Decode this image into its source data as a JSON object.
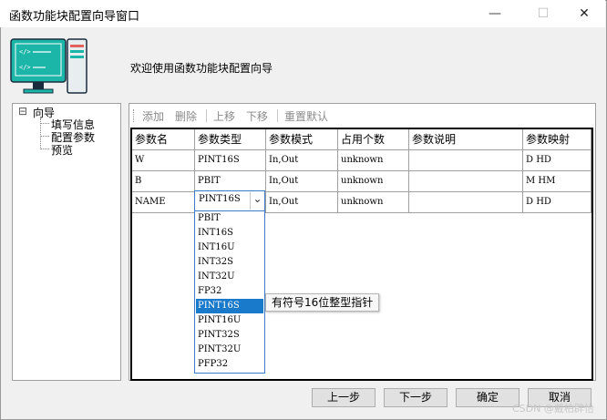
{
  "window": {
    "title": "函数功能块配置向导窗口",
    "minimize": "—",
    "maximize": "☐",
    "close": "✕"
  },
  "header": {
    "welcome": "欢迎使用函数功能块配置向导"
  },
  "tree": {
    "root": {
      "toggle": "⊟",
      "label": "向导"
    },
    "children": [
      "填写信息",
      "配置参数",
      "预览"
    ]
  },
  "toolbar": {
    "add": "添加",
    "delete": "删除",
    "move_up": "上移",
    "move_down": "下移",
    "reset": "重置默认"
  },
  "table": {
    "columns": [
      "参数名",
      "参数类型",
      "参数模式",
      "占用个数",
      "参数说明",
      "参数映射"
    ],
    "rows": [
      [
        "W",
        "PINT16S",
        "In,Out",
        "unknown",
        "",
        "D HD"
      ],
      [
        "B",
        "PBIT",
        "In,Out",
        "unknown",
        "",
        "M HM"
      ],
      [
        "NAME",
        "PINT16S",
        "In,Out",
        "unknown",
        "",
        "D HD"
      ]
    ]
  },
  "combo": {
    "value": "PINT16S",
    "arrow": "⌄",
    "options": [
      "PBIT",
      "INT16S",
      "INT16U",
      "INT32S",
      "INT32U",
      "FP32",
      "PINT16S",
      "PINT16U",
      "PINT32S",
      "PINT32U",
      "PFP32"
    ],
    "selected_index": 6
  },
  "tooltip": "有符号16位整型指针",
  "buttons": {
    "prev": "上一步",
    "next": "下一步",
    "ok": "确定",
    "cancel": "取消"
  },
  "watermark": "CSDN @戴柏辟怡",
  "colors": {
    "selection": "#1979ca",
    "combo_border": "#3d7cc9",
    "illustration": "#1bb6a8"
  },
  "icons": {
    "illustration": "computer-icon"
  }
}
